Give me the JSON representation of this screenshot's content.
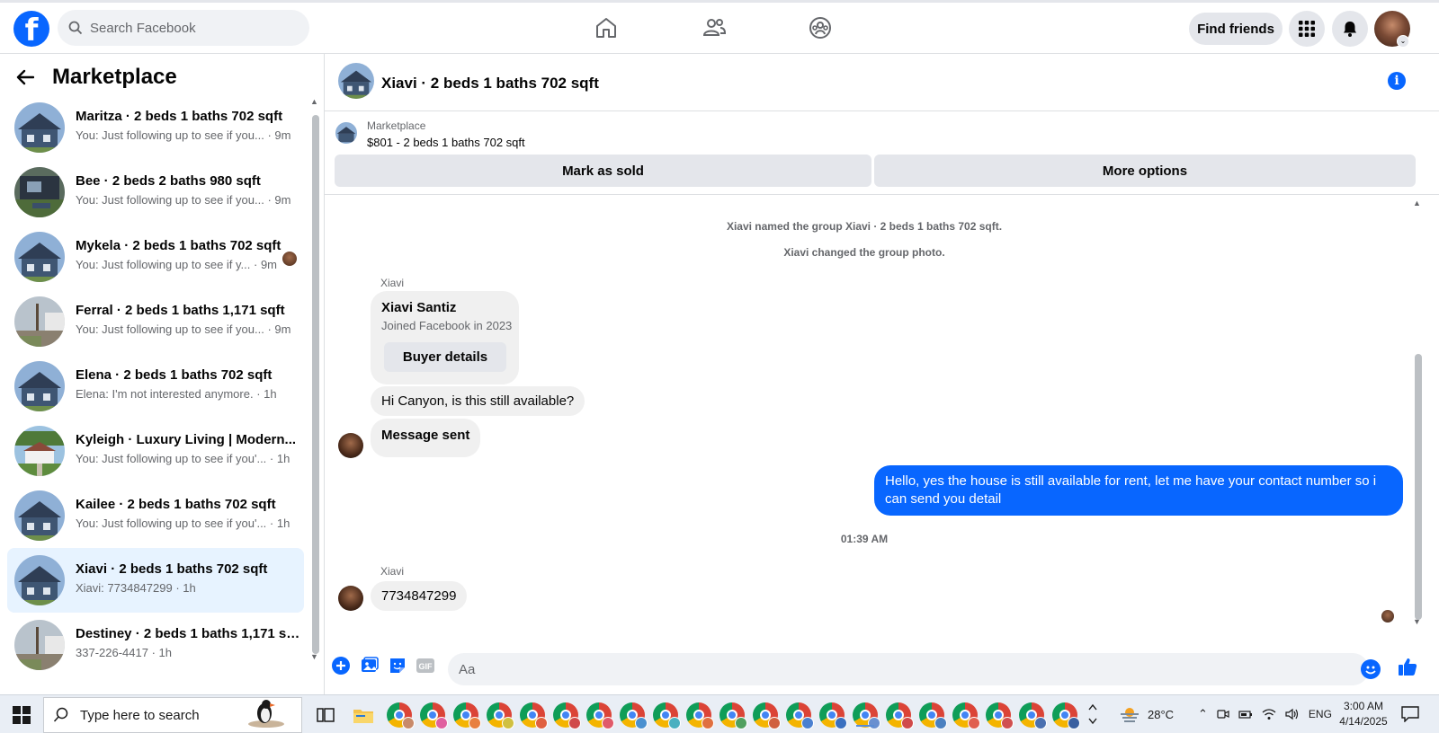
{
  "topbar": {
    "search_placeholder": "Search Facebook",
    "find_friends": "Find friends"
  },
  "sidebar": {
    "title": "Marketplace",
    "conversations": [
      {
        "name": "Maritza · 2 beds 1 baths 702 sqft",
        "preview": "You: Just following up to see if you...",
        "time": "9m"
      },
      {
        "name": "Bee · 2 beds 2 baths 980 sqft",
        "preview": "You: Just following up to see if you...",
        "time": "9m"
      },
      {
        "name": "Mykela · 2 beds 1 baths 702 sqft",
        "preview": "You: Just following up to see if y...",
        "time": "9m"
      },
      {
        "name": "Ferral · 2 beds 1 baths 1,171 sqft",
        "preview": "You: Just following up to see if you...",
        "time": "9m"
      },
      {
        "name": "Elena · 2 beds 1 baths 702 sqft",
        "preview": "Elena: I'm not interested anymore.",
        "time": "1h"
      },
      {
        "name": "Kyleigh · Luxury Living | Modern...",
        "preview": "You: Just following up to see if you'...",
        "time": "1h"
      },
      {
        "name": "Kailee · 2 beds 1 baths 702 sqft",
        "preview": "You: Just following up to see if you'...",
        "time": "1h"
      },
      {
        "name": "Xiavi · 2 beds 1 baths 702 sqft",
        "preview": "Xiavi: 7734847299",
        "time": "1h"
      },
      {
        "name": "Destiney · 2 beds 1 baths 1,171 sqft",
        "preview": "337-226-4417",
        "time": "1h"
      }
    ]
  },
  "chat": {
    "title": "Xiavi · 2 beds 1 baths 702 sqft",
    "listing_source": "Marketplace",
    "listing_price": "$801 - 2 beds 1 baths 702 sqft",
    "mark_sold": "Mark as sold",
    "more_options": "More options",
    "sys_named": "Xiavi named the group Xiavi · 2 beds 1 baths 702 sqft.",
    "sys_photo": "Xiavi changed the group photo.",
    "sender_1": "Xiavi",
    "card_name": "Xiavi Santiz",
    "card_joined": "Joined Facebook in 2023",
    "buyer_details": "Buyer details",
    "msg_1": "Hi Canyon, is this still available?",
    "msg_2": "Message sent",
    "msg_out": "Hello, yes the house is still available for rent, let me have your contact number so i can send you detail",
    "time_sep": "01:39 AM",
    "sender_2": "Xiavi",
    "msg_3": "7734847299",
    "input_placeholder": "Aa"
  },
  "taskbar": {
    "search_placeholder": "Type here to search",
    "temperature": "28°C",
    "language": "ENG",
    "time": "3:00 AM",
    "date": "4/14/2025"
  },
  "colors": {
    "facebook_blue": "#0866ff",
    "active_row": "#e7f3ff",
    "bubble_gray": "#f0f0f0"
  }
}
